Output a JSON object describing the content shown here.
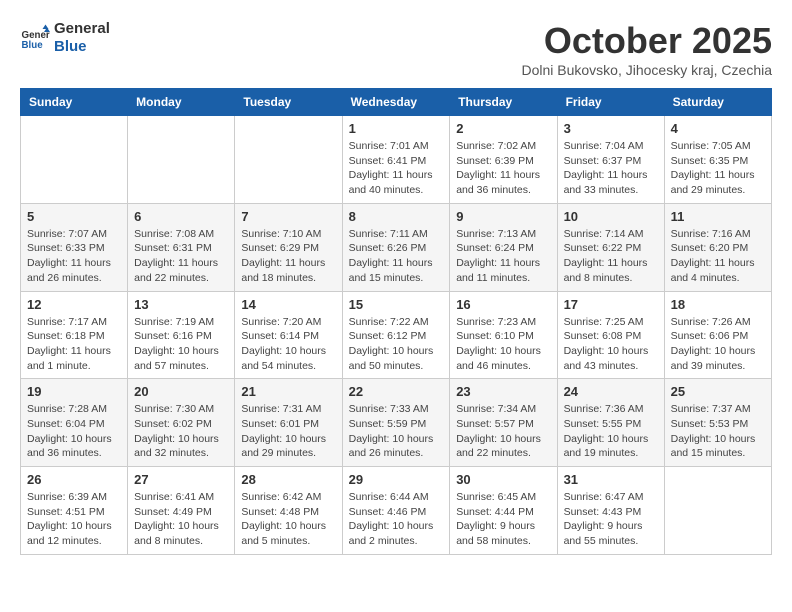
{
  "header": {
    "logo_line1": "General",
    "logo_line2": "Blue",
    "month_title": "October 2025",
    "location": "Dolni Bukovsko, Jihocesky kraj, Czechia"
  },
  "weekdays": [
    "Sunday",
    "Monday",
    "Tuesday",
    "Wednesday",
    "Thursday",
    "Friday",
    "Saturday"
  ],
  "weeks": [
    [
      {
        "day": "",
        "info": ""
      },
      {
        "day": "",
        "info": ""
      },
      {
        "day": "",
        "info": ""
      },
      {
        "day": "1",
        "info": "Sunrise: 7:01 AM\nSunset: 6:41 PM\nDaylight: 11 hours and 40 minutes."
      },
      {
        "day": "2",
        "info": "Sunrise: 7:02 AM\nSunset: 6:39 PM\nDaylight: 11 hours and 36 minutes."
      },
      {
        "day": "3",
        "info": "Sunrise: 7:04 AM\nSunset: 6:37 PM\nDaylight: 11 hours and 33 minutes."
      },
      {
        "day": "4",
        "info": "Sunrise: 7:05 AM\nSunset: 6:35 PM\nDaylight: 11 hours and 29 minutes."
      }
    ],
    [
      {
        "day": "5",
        "info": "Sunrise: 7:07 AM\nSunset: 6:33 PM\nDaylight: 11 hours and 26 minutes."
      },
      {
        "day": "6",
        "info": "Sunrise: 7:08 AM\nSunset: 6:31 PM\nDaylight: 11 hours and 22 minutes."
      },
      {
        "day": "7",
        "info": "Sunrise: 7:10 AM\nSunset: 6:29 PM\nDaylight: 11 hours and 18 minutes."
      },
      {
        "day": "8",
        "info": "Sunrise: 7:11 AM\nSunset: 6:26 PM\nDaylight: 11 hours and 15 minutes."
      },
      {
        "day": "9",
        "info": "Sunrise: 7:13 AM\nSunset: 6:24 PM\nDaylight: 11 hours and 11 minutes."
      },
      {
        "day": "10",
        "info": "Sunrise: 7:14 AM\nSunset: 6:22 PM\nDaylight: 11 hours and 8 minutes."
      },
      {
        "day": "11",
        "info": "Sunrise: 7:16 AM\nSunset: 6:20 PM\nDaylight: 11 hours and 4 minutes."
      }
    ],
    [
      {
        "day": "12",
        "info": "Sunrise: 7:17 AM\nSunset: 6:18 PM\nDaylight: 11 hours and 1 minute."
      },
      {
        "day": "13",
        "info": "Sunrise: 7:19 AM\nSunset: 6:16 PM\nDaylight: 10 hours and 57 minutes."
      },
      {
        "day": "14",
        "info": "Sunrise: 7:20 AM\nSunset: 6:14 PM\nDaylight: 10 hours and 54 minutes."
      },
      {
        "day": "15",
        "info": "Sunrise: 7:22 AM\nSunset: 6:12 PM\nDaylight: 10 hours and 50 minutes."
      },
      {
        "day": "16",
        "info": "Sunrise: 7:23 AM\nSunset: 6:10 PM\nDaylight: 10 hours and 46 minutes."
      },
      {
        "day": "17",
        "info": "Sunrise: 7:25 AM\nSunset: 6:08 PM\nDaylight: 10 hours and 43 minutes."
      },
      {
        "day": "18",
        "info": "Sunrise: 7:26 AM\nSunset: 6:06 PM\nDaylight: 10 hours and 39 minutes."
      }
    ],
    [
      {
        "day": "19",
        "info": "Sunrise: 7:28 AM\nSunset: 6:04 PM\nDaylight: 10 hours and 36 minutes."
      },
      {
        "day": "20",
        "info": "Sunrise: 7:30 AM\nSunset: 6:02 PM\nDaylight: 10 hours and 32 minutes."
      },
      {
        "day": "21",
        "info": "Sunrise: 7:31 AM\nSunset: 6:01 PM\nDaylight: 10 hours and 29 minutes."
      },
      {
        "day": "22",
        "info": "Sunrise: 7:33 AM\nSunset: 5:59 PM\nDaylight: 10 hours and 26 minutes."
      },
      {
        "day": "23",
        "info": "Sunrise: 7:34 AM\nSunset: 5:57 PM\nDaylight: 10 hours and 22 minutes."
      },
      {
        "day": "24",
        "info": "Sunrise: 7:36 AM\nSunset: 5:55 PM\nDaylight: 10 hours and 19 minutes."
      },
      {
        "day": "25",
        "info": "Sunrise: 7:37 AM\nSunset: 5:53 PM\nDaylight: 10 hours and 15 minutes."
      }
    ],
    [
      {
        "day": "26",
        "info": "Sunrise: 6:39 AM\nSunset: 4:51 PM\nDaylight: 10 hours and 12 minutes."
      },
      {
        "day": "27",
        "info": "Sunrise: 6:41 AM\nSunset: 4:49 PM\nDaylight: 10 hours and 8 minutes."
      },
      {
        "day": "28",
        "info": "Sunrise: 6:42 AM\nSunset: 4:48 PM\nDaylight: 10 hours and 5 minutes."
      },
      {
        "day": "29",
        "info": "Sunrise: 6:44 AM\nSunset: 4:46 PM\nDaylight: 10 hours and 2 minutes."
      },
      {
        "day": "30",
        "info": "Sunrise: 6:45 AM\nSunset: 4:44 PM\nDaylight: 9 hours and 58 minutes."
      },
      {
        "day": "31",
        "info": "Sunrise: 6:47 AM\nSunset: 4:43 PM\nDaylight: 9 hours and 55 minutes."
      },
      {
        "day": "",
        "info": ""
      }
    ]
  ]
}
